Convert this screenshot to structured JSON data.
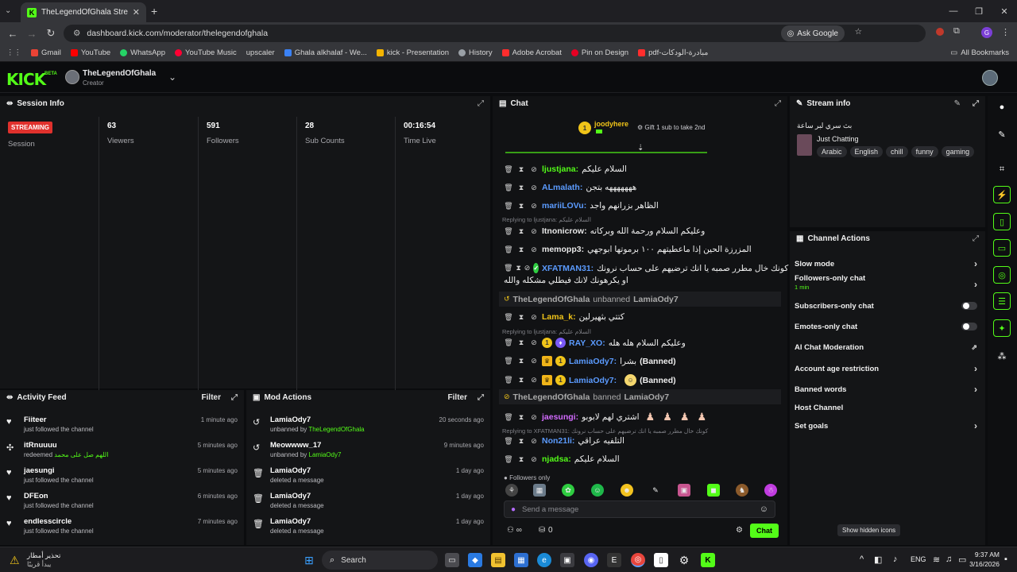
{
  "browser": {
    "tab_title": "TheLegendOfGhala Stream - Ki",
    "url": "dashboard.kick.com/moderator/thelegendofghala",
    "ask_google": "Ask Google",
    "all_bookmarks": "All Bookmarks",
    "bookmarks": [
      {
        "label": "Gmail",
        "color": "#ea4335"
      },
      {
        "label": "YouTube",
        "color": "#ff0000"
      },
      {
        "label": "WhatsApp",
        "color": "#25d366"
      },
      {
        "label": "YouTube Music",
        "color": "#ff0033"
      },
      {
        "label": "upscaler",
        "color": "#8a8a8a"
      },
      {
        "label": "Ghala alkhalaf - We...",
        "color": "#3b82f6"
      },
      {
        "label": "kick - Presentation",
        "color": "#f4b400"
      },
      {
        "label": "History",
        "color": "#9aa0a6"
      },
      {
        "label": "Adobe Acrobat",
        "color": "#ff2d2d"
      },
      {
        "label": "Pin on Design",
        "color": "#e60023"
      },
      {
        "label": "pdf-مبادرة-الودكات",
        "color": "#ff2d2d"
      }
    ]
  },
  "header": {
    "logo": "KICK",
    "channel_name": "TheLegendOfGhala",
    "channel_role": "Creator"
  },
  "session": {
    "title": "Session Info",
    "status": "STREAMING",
    "session_label": "Session",
    "stats": [
      {
        "value": "63",
        "label": "Viewers"
      },
      {
        "value": "591",
        "label": "Followers"
      },
      {
        "value": "28",
        "label": "Sub Counts"
      },
      {
        "value": "00:16:54",
        "label": "Time Live"
      }
    ]
  },
  "activity": {
    "title": "Activity Feed",
    "filter": "Filter",
    "items": [
      {
        "icon": "heart-icon",
        "name": "Fiiteer",
        "sub": "just followed the channel",
        "time": "1 minute ago"
      },
      {
        "icon": "redeem-icon",
        "name": "itRnuuuu",
        "sub": "redeemed",
        "highlight": "اللهم صل على محمد",
        "time": "5 minutes ago"
      },
      {
        "icon": "heart-icon",
        "name": "jaesungi",
        "sub": "just followed the channel",
        "time": "5 minutes ago"
      },
      {
        "icon": "heart-icon",
        "name": "DFEon",
        "sub": "just followed the channel",
        "time": "6 minutes ago"
      },
      {
        "icon": "heart-icon",
        "name": "endlesscircle",
        "sub": "just followed the channel",
        "time": "7 minutes ago"
      }
    ]
  },
  "modactions": {
    "title": "Mod Actions",
    "filter": "Filter",
    "items": [
      {
        "icon": "unban-icon",
        "name": "LamiaOdy7",
        "sub": "unbanned by",
        "by": "TheLegendOfGhala",
        "time": "20 seconds ago"
      },
      {
        "icon": "unban-icon",
        "name": "Meowwww_17",
        "sub": "unbanned by",
        "by": "LamiaOdy7",
        "time": "9 minutes ago"
      },
      {
        "icon": "trash-icon",
        "name": "LamiaOdy7",
        "sub": "deleted a message",
        "by": "",
        "time": "1 day ago"
      },
      {
        "icon": "trash-icon",
        "name": "LamiaOdy7",
        "sub": "deleted a message",
        "by": "",
        "time": "1 day ago"
      },
      {
        "icon": "trash-icon",
        "name": "LamiaOdy7",
        "sub": "deleted a message",
        "by": "",
        "time": "1 day ago"
      }
    ]
  },
  "chat": {
    "title": "Chat",
    "pinned_user": "joodyhere",
    "pinned_count": "1",
    "pinned_text": "Gift 1 sub to take 2nd",
    "followers_only": "Followers only",
    "placeholder": "Send a message",
    "send": "Chat",
    "points": "0",
    "messages": [
      {
        "user": "ljustjana:",
        "color": "#53fc18",
        "text": "السلام عليكم"
      },
      {
        "user": "ALmalath:",
        "color": "#5b9bff",
        "text": "هههههههه بتجن"
      },
      {
        "user": "mariiLOVu:",
        "color": "#5b9bff",
        "text": "الظاهر بزرانهم واجد"
      },
      {
        "user": "Itnonicrow:",
        "color": "#e8e8e8",
        "text": "وعليكم السلام ورحمة الله وبركاته",
        "reply": "Replying to ljustjana: السلام عليكم"
      },
      {
        "user": "memopp3:",
        "color": "#e8e8e8",
        "text": "المزرزة الحين إذا ماعطيتهم ١٠٠ برموتها ابوجهي"
      },
      {
        "user": "XFATMAN31:",
        "color": "#5b9bff",
        "text": "كونك خال مطرر صمبه يا انك ترضيهم على حساب نرونك",
        "text2": "او يكرهونك لانك فيطلي مشكله والله"
      }
    ],
    "system1": {
      "actor": "TheLegendOfGhala",
      "action": "unbanned",
      "target": "LamiaOdy7"
    },
    "messages2": [
      {
        "user": "Lama_k:",
        "color": "#f0c419",
        "text": "كتتي بثهيرلين"
      },
      {
        "user": "RAY_XO:",
        "color": "#5b9bff",
        "text": "وعليكم السلام هله هله",
        "reply": "Replying to ljustjana: السلام عليكم"
      },
      {
        "user": "LamiaOdy7:",
        "color": "#5b9bff",
        "text": "بشرا",
        "status": "(Banned)"
      },
      {
        "user": "LamiaOdy7:",
        "color": "#5b9bff",
        "text": "",
        "status": "(Banned)"
      }
    ],
    "system2": {
      "actor": "TheLegendOfGhala",
      "action": "banned",
      "target": "LamiaOdy7"
    },
    "messages3": [
      {
        "user": "jaesungi:",
        "color": "#d36bff",
        "text": "اشتري لهم لابوبو"
      },
      {
        "user": "Non21li:",
        "color": "#5b9bff",
        "text": "التلفيه عراقي",
        "reply": "Replying to XFATMAN31: كونك خال مطرر صمبه يا انك ترضيهم على حساب نرونك"
      },
      {
        "user": "njadsa:",
        "color": "#53fc18",
        "text": "السلام عليكم"
      }
    ]
  },
  "stream_info": {
    "title": "Stream info",
    "stream_title": "بث سري لبر ساعة",
    "category": "Just Chatting",
    "tags": [
      "Arabic",
      "English",
      "chill",
      "funny",
      "gaming"
    ]
  },
  "channel_actions": {
    "title": "Channel Actions",
    "items": [
      {
        "label": "Slow mode",
        "kind": "arrow"
      },
      {
        "label": "Followers-only chat",
        "kind": "arrow",
        "sub": "1 min"
      },
      {
        "label": "Subscribers-only chat",
        "kind": "toggle"
      },
      {
        "label": "Emotes-only chat",
        "kind": "toggle"
      },
      {
        "label": "AI Chat Moderation",
        "kind": "external"
      },
      {
        "label": "Account age restriction",
        "kind": "arrow"
      },
      {
        "label": "Banned words",
        "kind": "arrow"
      },
      {
        "label": "Host Channel",
        "kind": "none"
      },
      {
        "label": "Set goals",
        "kind": "arrow"
      }
    ],
    "tooltip": "Show hidden icons"
  },
  "taskbar": {
    "weather_line1": "تحذير أمطار",
    "weather_line2": "يبدأ قريبًا",
    "search": "Search",
    "lang": "ENG",
    "time": "9:37 AM",
    "date": "3/16/2026"
  }
}
